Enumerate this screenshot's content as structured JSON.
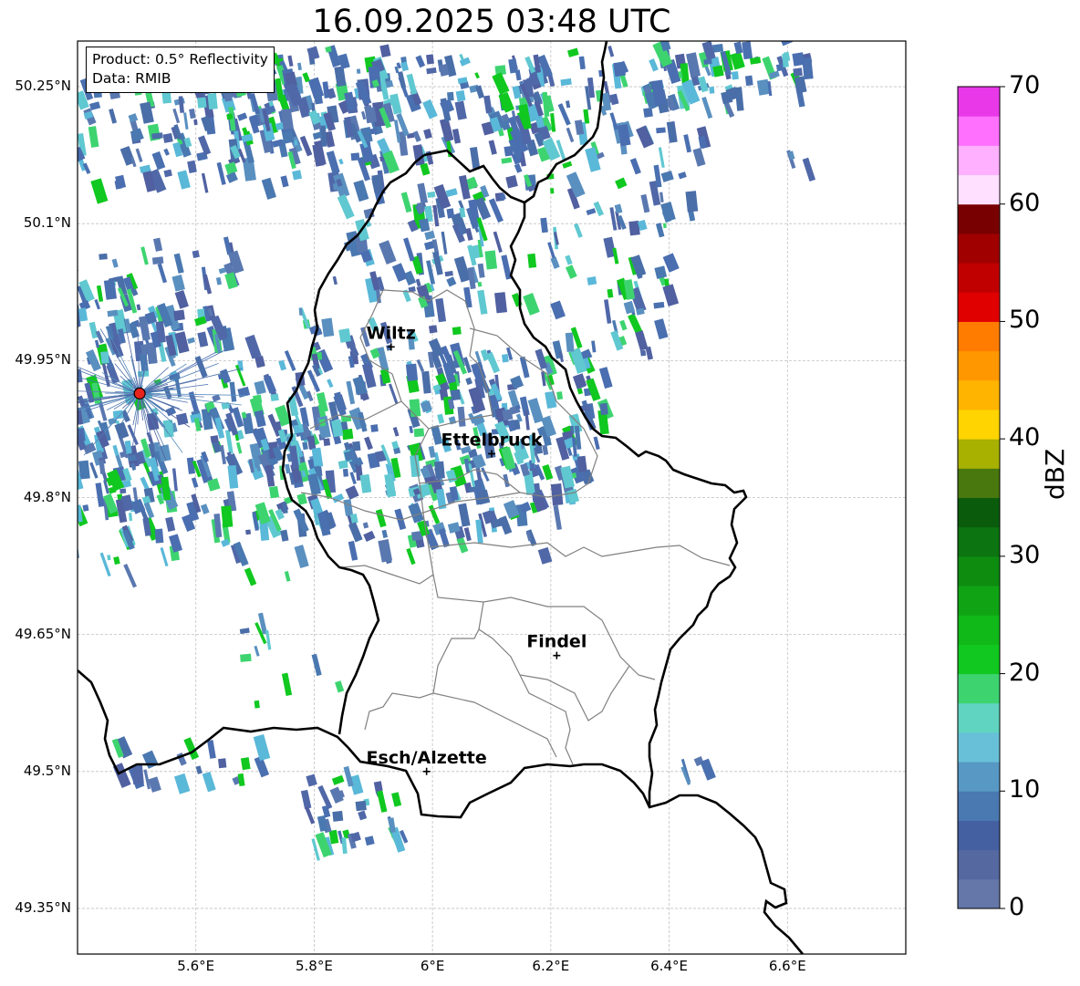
{
  "title": "16.09.2025 03:48 UTC",
  "info": {
    "product": "Product: 0.5° Reflectivity",
    "data": "Data: RMIB"
  },
  "extent": {
    "lon_min": 5.4,
    "lon_max": 6.8,
    "lat_min": 49.3,
    "lat_max": 50.3
  },
  "lat_ticks": [
    {
      "value": 50.25,
      "label": "50.25°N"
    },
    {
      "value": 50.1,
      "label": "50.1°N"
    },
    {
      "value": 49.95,
      "label": "49.95°N"
    },
    {
      "value": 49.8,
      "label": "49.8°N"
    },
    {
      "value": 49.65,
      "label": "49.65°N"
    },
    {
      "value": 49.5,
      "label": "49.5°N"
    },
    {
      "value": 49.35,
      "label": "49.35°N"
    }
  ],
  "lon_ticks": [
    {
      "value": 5.6,
      "label": "5.6°E"
    },
    {
      "value": 5.8,
      "label": "5.8°E"
    },
    {
      "value": 6.0,
      "label": "6°E"
    },
    {
      "value": 6.2,
      "label": "6.2°E"
    },
    {
      "value": 6.4,
      "label": "6.4°E"
    },
    {
      "value": 6.6,
      "label": "6.6°E"
    }
  ],
  "cities": [
    {
      "name": "Wiltz",
      "lon": 5.93,
      "lat": 49.965
    },
    {
      "name": "Ettelbruck",
      "lon": 6.1,
      "lat": 49.848
    },
    {
      "name": "Findel",
      "lon": 6.21,
      "lat": 49.627
    },
    {
      "name": "Esch/Alzette",
      "lon": 5.99,
      "lat": 49.5
    }
  ],
  "radar_site": {
    "lon": 5.505,
    "lat": 49.914,
    "color": "#e8231c"
  },
  "colorbar": {
    "label": "dBZ",
    "min": 0,
    "max": 70,
    "ticks": [
      "0",
      "10",
      "20",
      "30",
      "40",
      "50",
      "60",
      "70"
    ],
    "colors": [
      "#6577a8",
      "#5668a0",
      "#4460a0",
      "#4a78b0",
      "#5898c4",
      "#68c0d8",
      "#60d4c0",
      "#3dd470",
      "#10c820",
      "#10b818",
      "#10a414",
      "#0e8c10",
      "#0c7410",
      "#0a5c0c",
      "#48780e",
      "#a8b000",
      "#ffd400",
      "#ffb400",
      "#ff9800",
      "#ff7c00",
      "#e00000",
      "#c00000",
      "#a00000",
      "#780000",
      "#ffe0ff",
      "#ffb0ff",
      "#ff70ff",
      "#e838e8"
    ]
  },
  "colors": {
    "border": "#000000",
    "canton": "#808080",
    "grid": "#c0c0c0"
  }
}
